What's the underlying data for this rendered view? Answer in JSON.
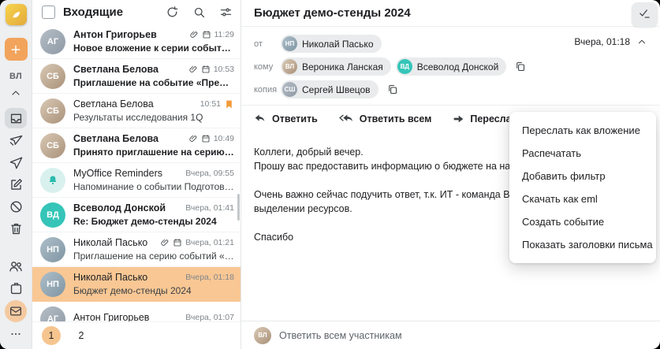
{
  "colors": {
    "accent_orange": "#f2a45c",
    "selected_row": "#f8c794",
    "teal_avatar": "#35c5b8",
    "flag_orange": "#f29b38",
    "sidebar_bg": "#edeff0",
    "chip_bg": "#e9ebec"
  },
  "icons": {
    "app-logo": "gold rounded square with white bird",
    "plus-icon": "+",
    "chevron-up-icon": "^",
    "inbox-icon": "tray",
    "outbox-icon": "paper-plane-crossed",
    "send-icon": "paper-plane",
    "compose-icon": "pencil-square",
    "spam-icon": "blocked-circle",
    "trash-icon": "trash-can",
    "contacts-icon": "two-people",
    "calendar-icon": "calendar-clasp",
    "mail-icon": "envelope",
    "ellipsis-icon": "...",
    "refresh-icon": "circular-arrow",
    "search-icon": "magnifier",
    "filter-icon": "sliders",
    "paperclip-icon": "paperclip",
    "event-icon": "small-calendar",
    "bookmark-icon": "orange-bookmark",
    "bell-icon": "bell",
    "reply-icon": "arrow-curved-left",
    "reply-all-icon": "double-arrow-curved-left",
    "forward-icon": "arrow-right",
    "open-in-new-icon": "square-with-arrow",
    "tag-icon": "label",
    "kebab-icon": "vertical-dots",
    "checklist-icon": "check-with-lines",
    "copy-icon": "two-squares"
  },
  "sidebar": {
    "profile_initials": "ВЛ"
  },
  "mail_list": {
    "title": "Входящие",
    "items": [
      {
        "sender": "Антон Григорьев",
        "initials": "АГ",
        "subject": "Новое вложение к серии событий «Аналити...",
        "time": "11:29",
        "unread": true,
        "attachment": true,
        "event": true
      },
      {
        "sender": "Светлана Белова",
        "initials": "СБ",
        "subject": "Приглашение на событие «Предварительно...",
        "time": "10:53",
        "unread": true,
        "attachment": true,
        "event": true
      },
      {
        "sender": "Светлана Белова",
        "initials": "СБ",
        "subject": "Результаты исследования 1Q",
        "time": "10:51",
        "unread": false,
        "flagged": true
      },
      {
        "sender": "Светлана Белова",
        "initials": "СБ",
        "subject": "Принято приглашение на серию событий «...",
        "time": "10:49",
        "unread": true,
        "attachment": true,
        "event": true
      },
      {
        "sender": "MyOffice Reminders",
        "initials": "",
        "subject": "Напоминание о событии Подготовить отчет...",
        "time": "Вчера, 09:55",
        "unread": false
      },
      {
        "sender": "Всеволод Донской",
        "initials": "ВД",
        "subject": "Re: Бюджет демо-стенды 2024",
        "time": "Вчера, 01:41",
        "unread": true
      },
      {
        "sender": "Николай Пасько",
        "initials": "НП",
        "subject": "Приглашение на серию событий «Демо стен...",
        "time": "Вчера, 01:21",
        "unread": false,
        "attachment": true,
        "event": true
      },
      {
        "sender": "Николай Пасько",
        "initials": "НП",
        "subject": "Бюджет демо-стенды 2024",
        "time": "Вчера, 01:18",
        "unread": false,
        "selected": true
      },
      {
        "sender": "Антон Григорьев",
        "initials": "АГ",
        "subject": "",
        "time": "Вчера, 01:07",
        "unread": false
      }
    ],
    "pagination": {
      "page1": "1",
      "page2": "2",
      "current": "1"
    }
  },
  "reading_pane": {
    "subject": "Бюджет демо-стенды 2024",
    "meta": {
      "from_label": "от",
      "from_name": "Николай Пасько",
      "from_initials": "НП",
      "to_label": "кому",
      "to1_name": "Вероника Ланская",
      "to1_initials": "ВЛ",
      "to2_name": "Всеволод Донской",
      "to2_initials": "ВД",
      "cc_label": "копия",
      "cc1_name": "Сергей Швецов",
      "cc1_initials": "СШ",
      "date": "Вчера, 01:18"
    },
    "actions": {
      "reply": "Ответить",
      "reply_all": "Ответить всем",
      "forward": "Переслать"
    },
    "body_lines": [
      "Коллеги, добрый вечер.",
      "Прошу вас предоставить информацию о бюджете на наши демонстраци",
      "Очень важно сейчас подучить ответ, т.к. ИТ - команда Всеволода, уже",
      "выделении ресурсов.",
      "Спасибо"
    ],
    "quick_reply_placeholder": "Ответить всем участникам",
    "quick_reply_initials": "ВЛ"
  },
  "context_menu": {
    "items": [
      "Переслать как вложение",
      "Распечатать",
      "Добавить фильтр",
      "Скачать как eml",
      "Создать событие",
      "Показать заголовки письма"
    ]
  }
}
